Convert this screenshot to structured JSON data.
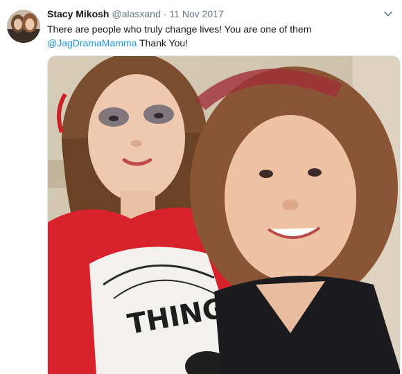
{
  "tweet": {
    "display_name": "Stacy Mikosh",
    "handle": "@alasxand",
    "separator": "·",
    "date": "11 Nov 2017",
    "text_line1": "There are people who truly change lives! You are one of them",
    "mention": "@JagDramaMamma",
    "text_after_mention": " Thank You!",
    "menu_icon": "chevron-down-icon",
    "photo_text": "THING"
  },
  "colors": {
    "link": "#1b95e0",
    "secondary_text": "#657786",
    "primary_text": "#14171a"
  }
}
